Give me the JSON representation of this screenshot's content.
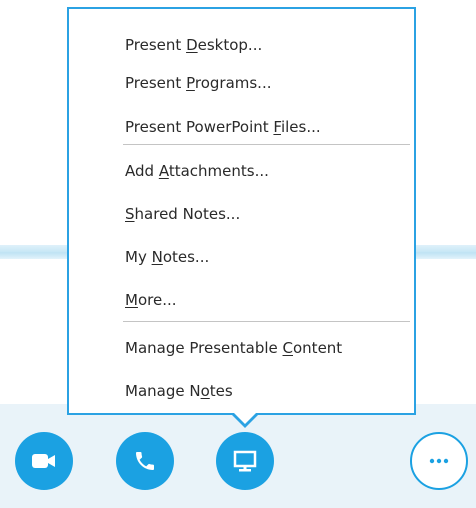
{
  "menu": {
    "items": [
      {
        "pre": "Present ",
        "key": "D",
        "post": "esktop..."
      },
      {
        "pre": "Present ",
        "key": "P",
        "post": "rograms..."
      },
      {
        "pre": "Present PowerPoint ",
        "key": "F",
        "post": "iles..."
      },
      {
        "pre": "Add ",
        "key": "A",
        "post": "ttachments..."
      },
      {
        "pre": "",
        "key": "S",
        "post": "hared Notes..."
      },
      {
        "pre": "My ",
        "key": "N",
        "post": "otes..."
      },
      {
        "pre": "",
        "key": "M",
        "post": "ore..."
      },
      {
        "pre": "Manage Presentable ",
        "key": "C",
        "post": "ontent"
      },
      {
        "pre": "Manage N",
        "key": "o",
        "post": "tes"
      }
    ]
  },
  "toolbar": {
    "buttons": [
      {
        "name": "video",
        "icon": "video-camera-icon"
      },
      {
        "name": "call",
        "icon": "phone-icon"
      },
      {
        "name": "present",
        "icon": "monitor-icon"
      },
      {
        "name": "more",
        "icon": "ellipsis-icon"
      }
    ]
  },
  "colors": {
    "accent": "#1ba1e2",
    "menu_border": "#2ba2e3",
    "toolbar_bg": "#e9f3f9",
    "menu_text": "#2a2a2a"
  }
}
